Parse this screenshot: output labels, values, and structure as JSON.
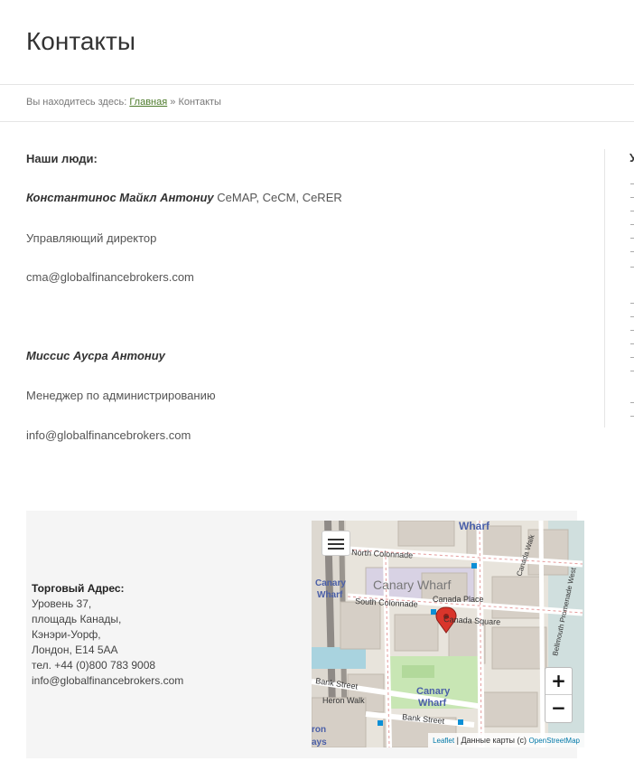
{
  "page": {
    "title": "Контакты"
  },
  "breadcrumb": {
    "prefix": "Вы находитесь здесь:",
    "home": "Главная",
    "separator": "»",
    "current": "Контакты"
  },
  "people": {
    "heading": "Наши люди:",
    "person1": {
      "name": "Константинос Майкл Антониу",
      "credentials": "CeMAP, CeCM, CeRER",
      "role": "Управляющий директор",
      "email": "cma@globalfinancebrokers.com"
    },
    "person2": {
      "name": "Миссис Аусра Антониу",
      "role": "Менеджер по администрированию",
      "email": "info@globalfinancebrokers.com"
    }
  },
  "sidebar": {
    "letter": "У"
  },
  "address": {
    "title": "Торговый Адрес:",
    "line1": "Уровень 37,",
    "line2": "площадь Канады,",
    "line3": "Кэнэри-Уорф,",
    "line4": "Лондон, E14 5AA",
    "phone": "тел. +44 (0)800 783 9008",
    "email": "info@globalfinancebrokers.com"
  },
  "map": {
    "labels": {
      "wharf_top": "Wharf",
      "north_colonnade": "North Colonnade",
      "canary_wharf": "Canary Wharf",
      "canary_left": "Canary",
      "wharf_left": "Wharf",
      "canada_place": "Canada Place",
      "south_colonnade": "South Colonnade",
      "canada_square": "Canada Square",
      "canada_walk": "Canada Walk",
      "bellmouth": "Bellmouth Promenade West",
      "bank_street_left": "Bank Street",
      "heron_walk": "Heron Walk",
      "canary_bottom": "Canary",
      "wharf_bottom": "Wharf",
      "bank_street": "Bank Street",
      "ron": "ron",
      "ays": "ays"
    },
    "zoom_in": "+",
    "zoom_out": "−",
    "attribution": {
      "leaflet": "Leaflet",
      "text": "| Данные карты (c)",
      "osm": "OpenStreetMap"
    },
    "colors": {
      "land": "#e8e4dc",
      "building": "#d6cfc6",
      "water": "#a9d3df",
      "park": "#c8e6b4",
      "road": "#ffffff",
      "label_blue": "#4a5fa8",
      "marker": "#d9352b"
    }
  }
}
